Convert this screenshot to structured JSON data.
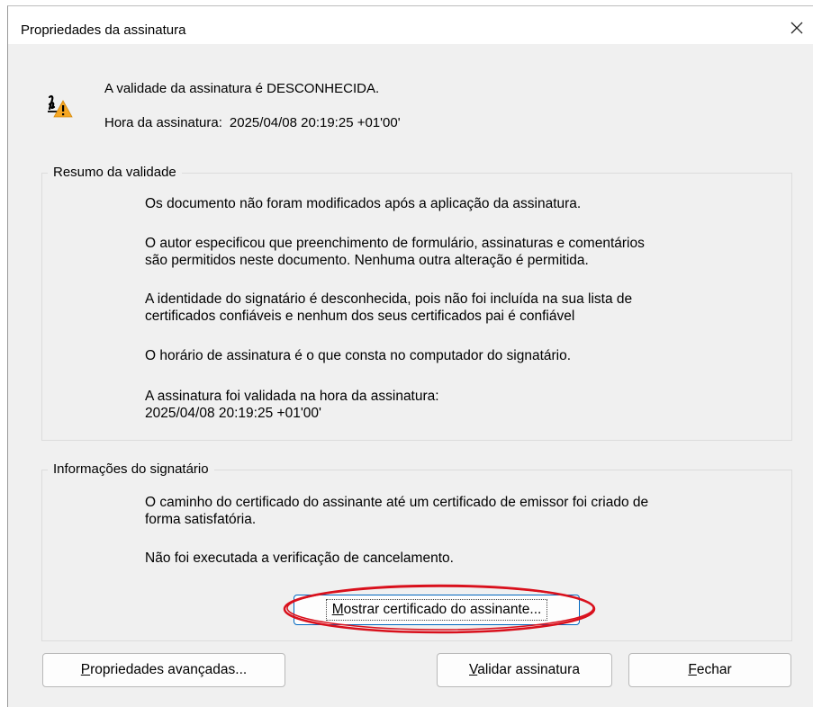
{
  "window": {
    "title": "Propriedades da assinatura",
    "close_icon": "close-icon"
  },
  "status": {
    "icon": "signature-warning-icon",
    "validity": "A validade da assinatura é DESCONHECIDA.",
    "time_label": "Hora da assinatura:",
    "time_value": "2025/04/08 20:19:25 +01'00'",
    "warning_color": "#f5a623"
  },
  "validation_summary": {
    "heading": "Resumo da validade",
    "paragraphs": [
      {
        "lines": [
          "Os documento não foram modificados após a aplicação da assinatura."
        ]
      },
      {
        "lines": [
          "O autor especificou que preenchimento de formulário, assinaturas e comentários",
          "são permitidos neste documento. Nenhuma outra alteração é permitida."
        ]
      },
      {
        "lines": [
          "A identidade do signatário é desconhecida, pois não foi incluída na sua lista de",
          "certificados confiáveis e nenhum dos seus certificados pai é confiável"
        ]
      },
      {
        "lines": [
          "O horário de assinatura é o que consta no computador do signatário."
        ]
      },
      {
        "lines": [
          "A assinatura foi validada na hora da assinatura:",
          "2025/04/08 20:19:25 +01'00'"
        ]
      }
    ]
  },
  "signer_info": {
    "heading": "Informações do signatário",
    "paragraphs": [
      {
        "lines": [
          "O caminho do certificado do assinante até um certificado de emissor foi criado de",
          "forma satisfatória."
        ]
      },
      {
        "lines": [
          "Não foi executada a verificação de cancelamento."
        ]
      }
    ],
    "show_cert_button": {
      "accel": "M",
      "rest": "ostrar certificado do assinante..."
    },
    "highlight_color": "#d9101c"
  },
  "footer": {
    "advanced_button": {
      "accel": "P",
      "rest": "ropriedades avançadas..."
    },
    "validate_button": {
      "accel": "V",
      "rest": "alidar assinatura"
    },
    "close_button": {
      "accel": "F",
      "rest": "echar"
    }
  }
}
